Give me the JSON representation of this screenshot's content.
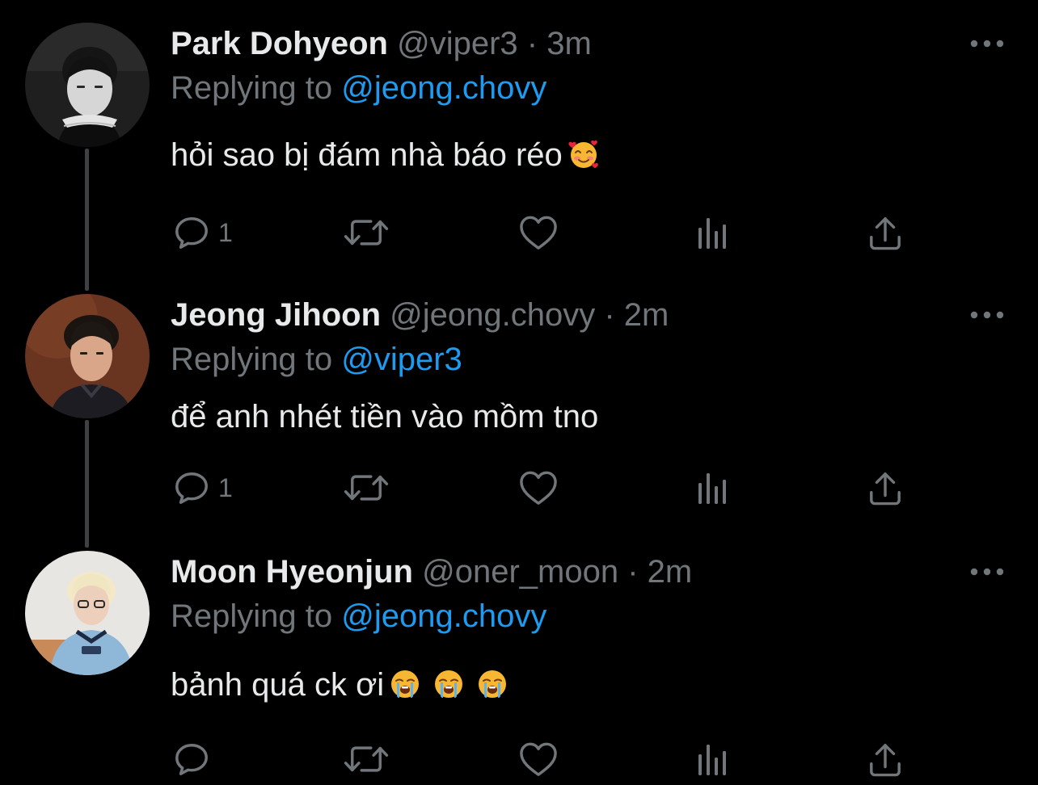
{
  "colors": {
    "background": "#000000",
    "text": "#e7e9ea",
    "muted": "#71767b",
    "link": "#1d9bf0",
    "thread_line": "#3e4144"
  },
  "tweets": [
    {
      "name": "Park Dohyeon",
      "handle": "@viper3",
      "separator": "·",
      "time": "3m",
      "replying_prefix": "Replying to",
      "replying_to": "@jeong.chovy",
      "text": "hỏi sao bị đám nhà báo réo",
      "emoji": "smiling-face-with-hearts",
      "reply_count": "1",
      "avatar": "grayscale-portrait"
    },
    {
      "name": "Jeong Jihoon",
      "handle": "@jeong.chovy",
      "separator": "·",
      "time": "2m",
      "replying_prefix": "Replying to",
      "replying_to": "@viper3",
      "text": "để anh nhét tiền vào mồm tno",
      "reply_count": "1",
      "avatar": "brown-portrait"
    },
    {
      "name": "Moon Hyeonjun",
      "handle": "@oner_moon",
      "separator": "·",
      "time": "2m",
      "replying_prefix": "Replying to",
      "replying_to": "@jeong.chovy",
      "text": "bảnh quá ck ơi",
      "emoji": "loudly-crying-face",
      "emoji_count": 3,
      "reply_count": "",
      "avatar": "light-portrait"
    }
  ],
  "icons": {
    "reply": "reply-icon",
    "retweet": "retweet-icon",
    "like": "heart-icon",
    "views": "views-icon",
    "share": "share-icon",
    "more": "more-icon"
  }
}
